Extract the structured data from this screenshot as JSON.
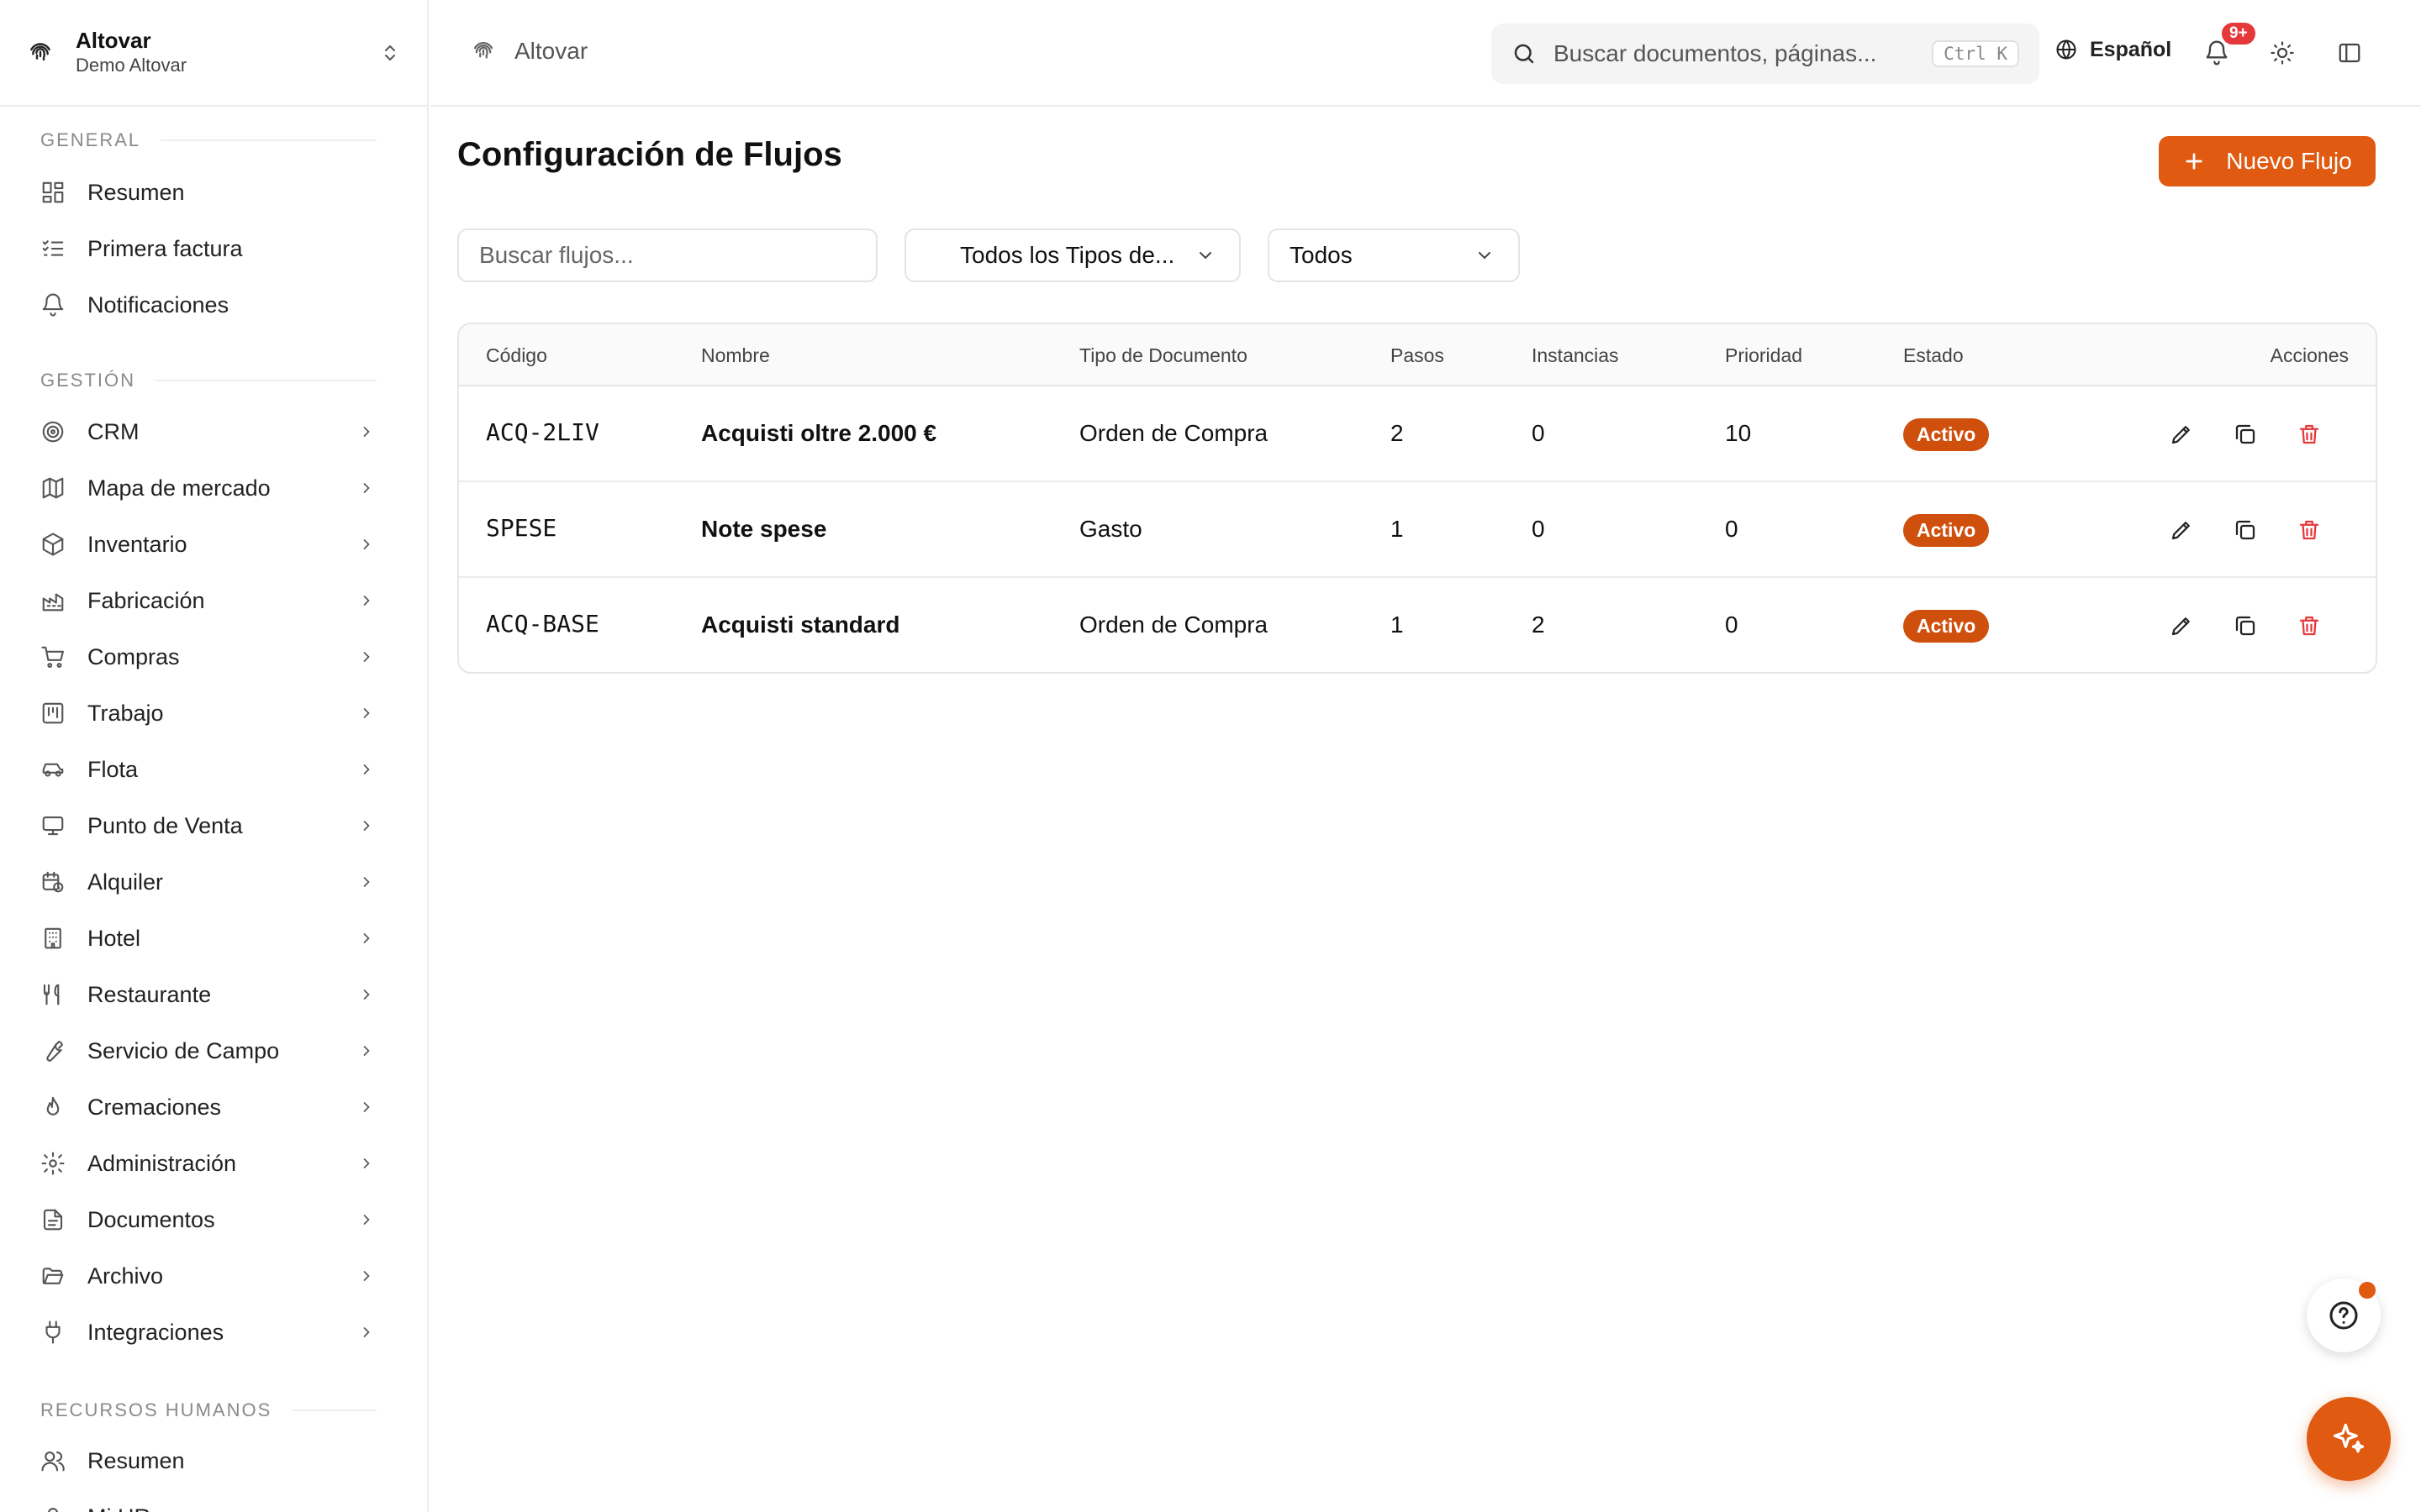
{
  "org": {
    "name": "Altovar",
    "subtitle": "Demo Altovar"
  },
  "sidebar": {
    "general_label": "GENERAL",
    "general_items": [
      {
        "label": "Resumen",
        "icon": "dashboard-icon"
      },
      {
        "label": "Primera factura",
        "icon": "checklist-icon"
      },
      {
        "label": "Notificaciones",
        "icon": "bell-icon"
      }
    ],
    "gestion_label": "GESTIÓN",
    "gestion_items": [
      {
        "label": "CRM",
        "icon": "target-icon"
      },
      {
        "label": "Mapa de mercado",
        "icon": "map-icon"
      },
      {
        "label": "Inventario",
        "icon": "package-icon"
      },
      {
        "label": "Fabricación",
        "icon": "factory-icon"
      },
      {
        "label": "Compras",
        "icon": "cart-icon"
      },
      {
        "label": "Trabajo",
        "icon": "kanban-icon"
      },
      {
        "label": "Flota",
        "icon": "car-icon"
      },
      {
        "label": "Punto de Venta",
        "icon": "monitor-icon"
      },
      {
        "label": "Alquiler",
        "icon": "calendar-clock-icon"
      },
      {
        "label": "Hotel",
        "icon": "building-icon"
      },
      {
        "label": "Restaurante",
        "icon": "utensils-icon"
      },
      {
        "label": "Servicio de Campo",
        "icon": "wrench-icon"
      },
      {
        "label": "Cremaciones",
        "icon": "flame-icon"
      },
      {
        "label": "Administración",
        "icon": "gear-icon"
      },
      {
        "label": "Documentos",
        "icon": "file-icon"
      },
      {
        "label": "Archivo",
        "icon": "folder-open-icon"
      },
      {
        "label": "Integraciones",
        "icon": "plug-icon"
      }
    ],
    "rrhh_label": "RECURSOS HUMANOS",
    "rrhh_items": [
      {
        "label": "Resumen",
        "icon": "users-icon"
      },
      {
        "label": "Mi HR",
        "icon": "user-icon"
      }
    ]
  },
  "topbar": {
    "breadcrumb": "Altovar",
    "search_placeholder": "Buscar documentos, páginas...",
    "shortcut": "Ctrl K",
    "language": "Español",
    "notifications_badge": "9+"
  },
  "main": {
    "title": "Configuración de Flujos",
    "new_button": "Nuevo Flujo",
    "filter_search_placeholder": "Buscar flujos...",
    "doc_type_filter": "Todos los Tipos de...",
    "status_filter": "Todos"
  },
  "table": {
    "headers": [
      "Código",
      "Nombre",
      "Tipo de Documento",
      "Pasos",
      "Instancias",
      "Prioridad",
      "Estado",
      "Acciones"
    ],
    "rows": [
      {
        "code": "ACQ-2LIV",
        "name": "Acquisti oltre 2.000 €",
        "doc_type": "Orden de Compra",
        "steps": "2",
        "instances": "0",
        "priority": "10",
        "status": "Activo"
      },
      {
        "code": "SPESE",
        "name": "Note spese",
        "doc_type": "Gasto",
        "steps": "1",
        "instances": "0",
        "priority": "0",
        "status": "Activo"
      },
      {
        "code": "ACQ-BASE",
        "name": "Acquisti standard",
        "doc_type": "Orden de Compra",
        "steps": "1",
        "instances": "2",
        "priority": "0",
        "status": "Activo"
      }
    ]
  },
  "colors": {
    "accent": "#e05a12",
    "status_active": "#cf4f0c",
    "delete": "#e5383b"
  }
}
